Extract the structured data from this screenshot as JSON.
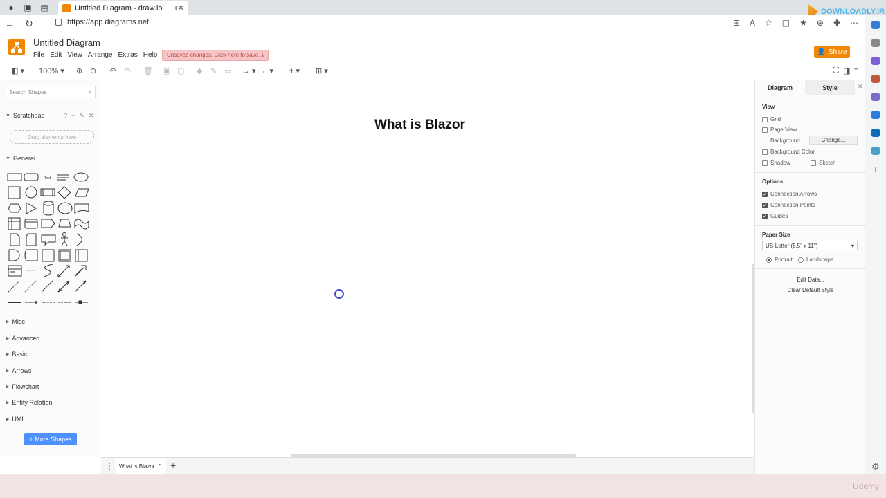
{
  "browser": {
    "tab_title": "Untitled Diagram - draw.io",
    "url": "https://app.diagrams.net",
    "watermark": "DOWNLOADLY.IR"
  },
  "app": {
    "doc_title": "Untitled Diagram",
    "menu": [
      "File",
      "Edit",
      "View",
      "Arrange",
      "Extras",
      "Help"
    ],
    "unsaved_notice": "Unsaved changes. Click here to save.",
    "share_label": "Share",
    "zoom": "100%"
  },
  "left_panel": {
    "search_placeholder": "Search Shapes",
    "scratchpad_label": "Scratchpad",
    "drop_hint": "Drag elements here",
    "general_label": "General",
    "sections": [
      "Misc",
      "Advanced",
      "Basic",
      "Arrows",
      "Flowchart",
      "Entity Relation",
      "UML"
    ],
    "more_shapes": "More Shapes"
  },
  "canvas": {
    "title": "What is Blazor"
  },
  "pages": {
    "current": "What is Blazor"
  },
  "format_panel": {
    "tabs": [
      "Diagram",
      "Style"
    ],
    "view_label": "View",
    "grid": "Grid",
    "page_view": "Page View",
    "background": "Background",
    "change": "Change...",
    "background_color": "Background Color",
    "shadow": "Shadow",
    "sketch": "Sketch",
    "options_label": "Options",
    "connection_arrows": "Connection Arrows",
    "connection_points": "Connection Points",
    "guides": "Guides",
    "paper_size_label": "Paper Size",
    "paper_size": "US-Letter (8.5\" x 11\")",
    "portrait": "Portrait",
    "landscape": "Landscape",
    "edit_data": "Edit Data...",
    "clear_style": "Clear Default Style"
  },
  "footer": {
    "udemy": "Udemy"
  },
  "colors": {
    "accent": "#f08705",
    "primary_button": "#4d90fe"
  }
}
